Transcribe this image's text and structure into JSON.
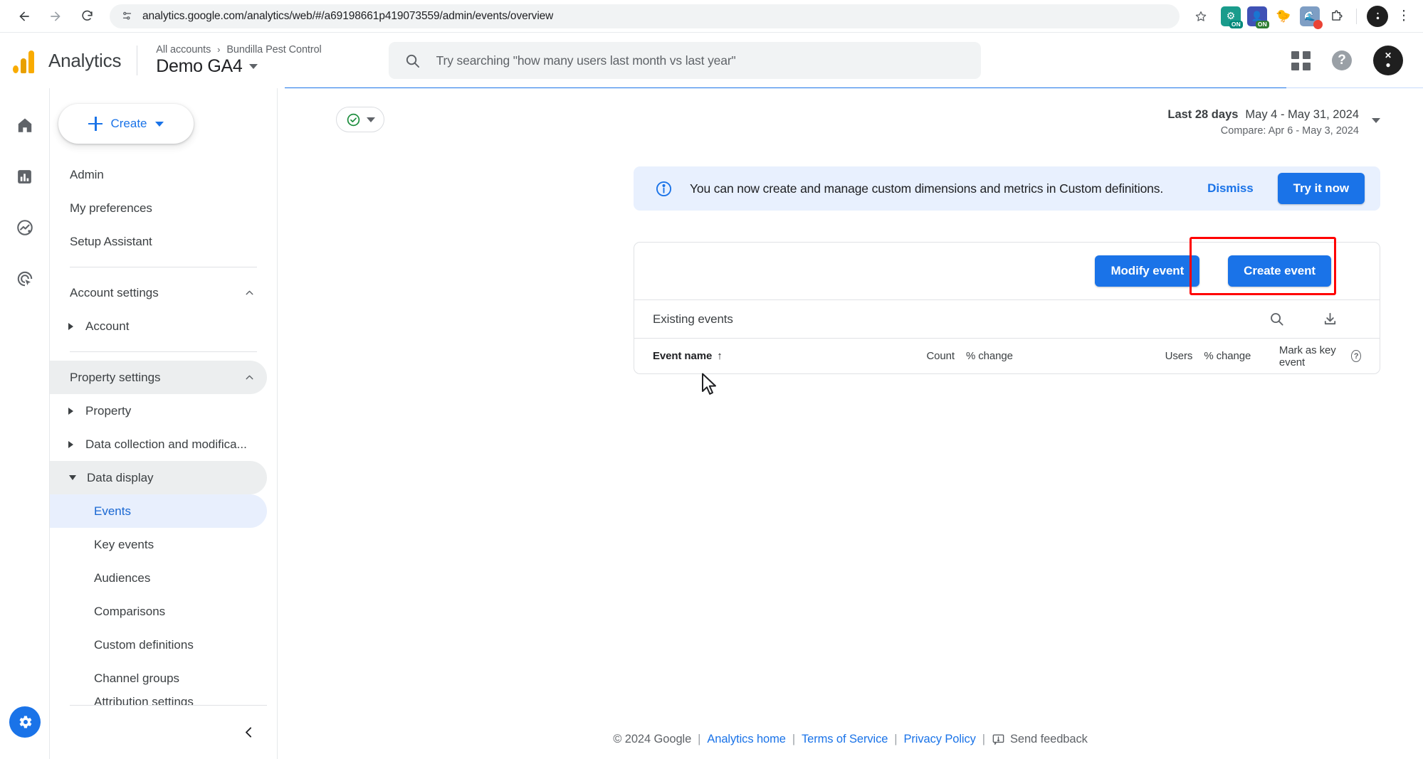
{
  "browser": {
    "url": "analytics.google.com/analytics/web/#/a69198661p419073559/admin/events/overview",
    "back_icon": "back-arrow-icon",
    "forward_icon": "forward-arrow-icon",
    "reload_icon": "reload-icon",
    "site_settings_icon": "site-settings-icon",
    "bookmark_icon": "star-icon",
    "extensions": [
      {
        "name": "extension-teal",
        "glyph": "⚙",
        "badge": "ON",
        "badge_color": "#00897b",
        "bg": "#1a9c8c"
      },
      {
        "name": "extension-blue",
        "glyph": "👤",
        "badge": "ON",
        "badge_color": "#2e7d32",
        "bg": "#3f51b5"
      },
      {
        "name": "extension-duck",
        "glyph": "🐥",
        "badge": "",
        "badge_color": "",
        "bg": "transparent"
      },
      {
        "name": "extension-record",
        "glyph": "🌊",
        "badge": "",
        "badge_color": "",
        "bg": "#7e9ec4"
      }
    ],
    "puzzle_icon": "extensions-puzzle-icon",
    "profile_initial": "✹",
    "menu_icon": "chrome-menu-icon"
  },
  "header": {
    "brand": "Analytics",
    "breadcrumb_all": "All accounts",
    "breadcrumb_sep": "›",
    "breadcrumb_account": "Bundilla Pest Control",
    "property_name": "Demo GA4",
    "search_placeholder": "Try searching \"how many users last month vs last year\"",
    "search_icon": "search-icon",
    "apps_icon": "google-apps-grid-icon",
    "help_icon": "help-icon",
    "help_glyph": "?",
    "avatar_icon": "user-avatar",
    "avatar_top": "✕",
    "avatar_bottom": "●"
  },
  "rail": {
    "items": [
      {
        "name": "home-icon",
        "label": "Home"
      },
      {
        "name": "reports-bar-chart-icon",
        "label": "Reports"
      },
      {
        "name": "explore-icon",
        "label": "Explore"
      },
      {
        "name": "advertising-target-icon",
        "label": "Advertising"
      }
    ],
    "admin": {
      "name": "admin-gear-icon",
      "label": "Admin",
      "color": "#1a73e8"
    }
  },
  "sidebar": {
    "create_label": "Create",
    "create_plus_icon": "plus-icon",
    "create_caret_icon": "chevron-down-icon",
    "top_items": [
      {
        "label": "Admin"
      },
      {
        "label": "My preferences"
      },
      {
        "label": "Setup Assistant"
      }
    ],
    "account_settings": {
      "label": "Account settings",
      "chevron": "chevron-up-icon"
    },
    "account_sub": {
      "label": "Account"
    },
    "property_settings": {
      "label": "Property settings",
      "chevron": "chevron-up-icon"
    },
    "property_sub": [
      {
        "label": "Property"
      },
      {
        "label": "Data collection and modifica..."
      }
    ],
    "data_display": {
      "label": "Data display"
    },
    "data_display_children": [
      {
        "label": "Events",
        "selected": true
      },
      {
        "label": "Key events",
        "selected": false
      },
      {
        "label": "Audiences",
        "selected": false
      },
      {
        "label": "Comparisons",
        "selected": false
      },
      {
        "label": "Custom definitions",
        "selected": false
      },
      {
        "label": "Channel groups",
        "selected": false
      }
    ],
    "clipped_item": "Attribution settings",
    "collapse_icon": "chevron-left-icon"
  },
  "main": {
    "status_chip": {
      "icon": "check-circle-icon",
      "caret": "chevron-down-icon",
      "color": "#1e8e3e"
    },
    "date_range": {
      "preset": "Last 28 days",
      "range": "May 4 - May 31, 2024",
      "compare": "Compare: Apr 6 - May 3, 2024",
      "caret": "chevron-down-icon"
    },
    "banner": {
      "icon": "info-icon",
      "text": "You can now create and manage custom dimensions and metrics in Custom definitions.",
      "dismiss_label": "Dismiss",
      "cta_label": "Try it now"
    },
    "card": {
      "modify_label": "Modify event",
      "create_label": "Create event",
      "highlight_color": "#ff0000",
      "subtitle": "Existing events",
      "search_icon": "search-icon",
      "download_icon": "download-icon",
      "columns": [
        {
          "label": "Event name",
          "sort_arrow": "↑"
        },
        {
          "label": "Count"
        },
        {
          "label": "% change"
        },
        {
          "label": "Users"
        },
        {
          "label": "% change"
        },
        {
          "label": "Mark as key event",
          "help": "?"
        }
      ],
      "rows": []
    },
    "cursor_icon": "mouse-cursor"
  },
  "footer": {
    "copyright": "© 2024 Google",
    "links": [
      {
        "label": "Analytics home"
      },
      {
        "label": "Terms of Service"
      },
      {
        "label": "Privacy Policy"
      }
    ],
    "feedback_label": "Send feedback",
    "feedback_icon": "feedback-icon"
  }
}
